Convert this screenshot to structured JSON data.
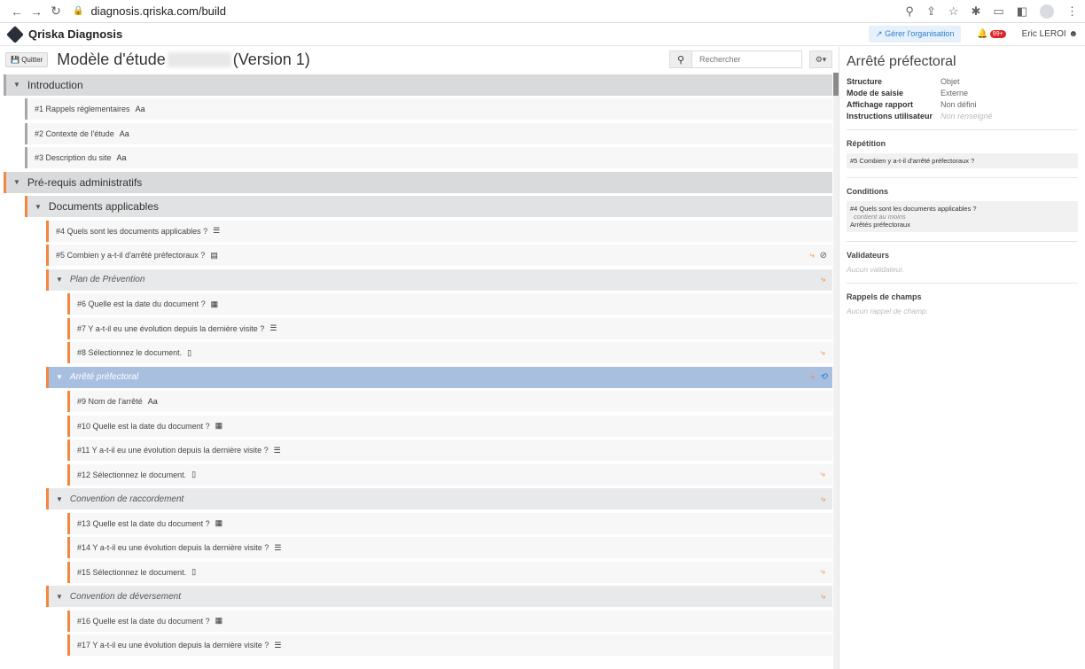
{
  "browser": {
    "url": "diagnosis.qriska.com/build"
  },
  "app": {
    "name": "Qriska Diagnosis",
    "org_button": "Gérer l'organisation",
    "notif_badge": "99+",
    "user": "Eric LEROI"
  },
  "toolbar": {
    "quit": "Quitter",
    "title_prefix": "Modèle d'étude",
    "title_suffix": "(Version 1)",
    "search_placeholder": "Rechercher"
  },
  "tree": {
    "introduction": "Introduction",
    "q1": "#1 Rappels réglementaires",
    "q2": "#2 Contexte de l'étude",
    "q3": "#3 Description du site",
    "prereq": "Pré-requis administratifs",
    "docs": "Documents applicables",
    "q4": "#4 Quels sont les documents applicables ?",
    "q5": "#5 Combien y a-t-il d'arrêté préfectoraux ?",
    "plan": "Plan de Prévention",
    "q6": "#6 Quelle est la date du document ?",
    "q7": "#7 Y a-t-il eu une évolution depuis la dernière visite ?",
    "q8": "#8 Sélectionnez le document.",
    "arrete": "Arrêté préfectoral",
    "q9": "#9 Nom de l'arrêté",
    "q10": "#10 Quelle est la date du document ?",
    "q11": "#11 Y a-t-il eu une évolution depuis la dernière visite ?",
    "q12": "#12 Sélectionnez le document.",
    "conv_racc": "Convention de raccordement",
    "q13": "#13 Quelle est la date du document ?",
    "q14": "#14 Y a-t-il eu une évolution depuis la dernière visite ?",
    "q15": "#15 Sélectionnez le document.",
    "conv_dev": "Convention de déversement",
    "q16": "#16 Quelle est la date du document ?",
    "q17": "#17 Y a-t-il eu une évolution depuis la dernière visite ?"
  },
  "side": {
    "title": "Arrêté préfectoral",
    "structure_k": "Structure",
    "structure_v": "Objet",
    "mode_k": "Mode de saisie",
    "mode_v": "Externe",
    "affichage_k": "Affichage rapport",
    "affichage_v": "Non défini",
    "instr_k": "Instructions utilisateur",
    "instr_v": "Non renseigné",
    "repetition": "Répétition",
    "repetition_v": "#5 Combien y a-t-il d'arrêté préfectoraux ?",
    "conditions": "Conditions",
    "cond_q": "#4 Quels sont les documents applicables ?",
    "cond_op": "contient au moins",
    "cond_val": "Arrêtés préfectoraux",
    "validateurs": "Validateurs",
    "validateurs_v": "Aucun validateur.",
    "rappels": "Rappels de champs",
    "rappels_v": "Aucun rappel de champ."
  },
  "icons": {
    "text": "Aa",
    "list": "☰",
    "calendar": "▦",
    "doc": "▯",
    "branch": "⤷",
    "calc": "▤"
  },
  "colors": {
    "accent_orange": "#f4873d",
    "selected_blue": "#a9bfe0",
    "link_blue": "#2d7fd0"
  }
}
